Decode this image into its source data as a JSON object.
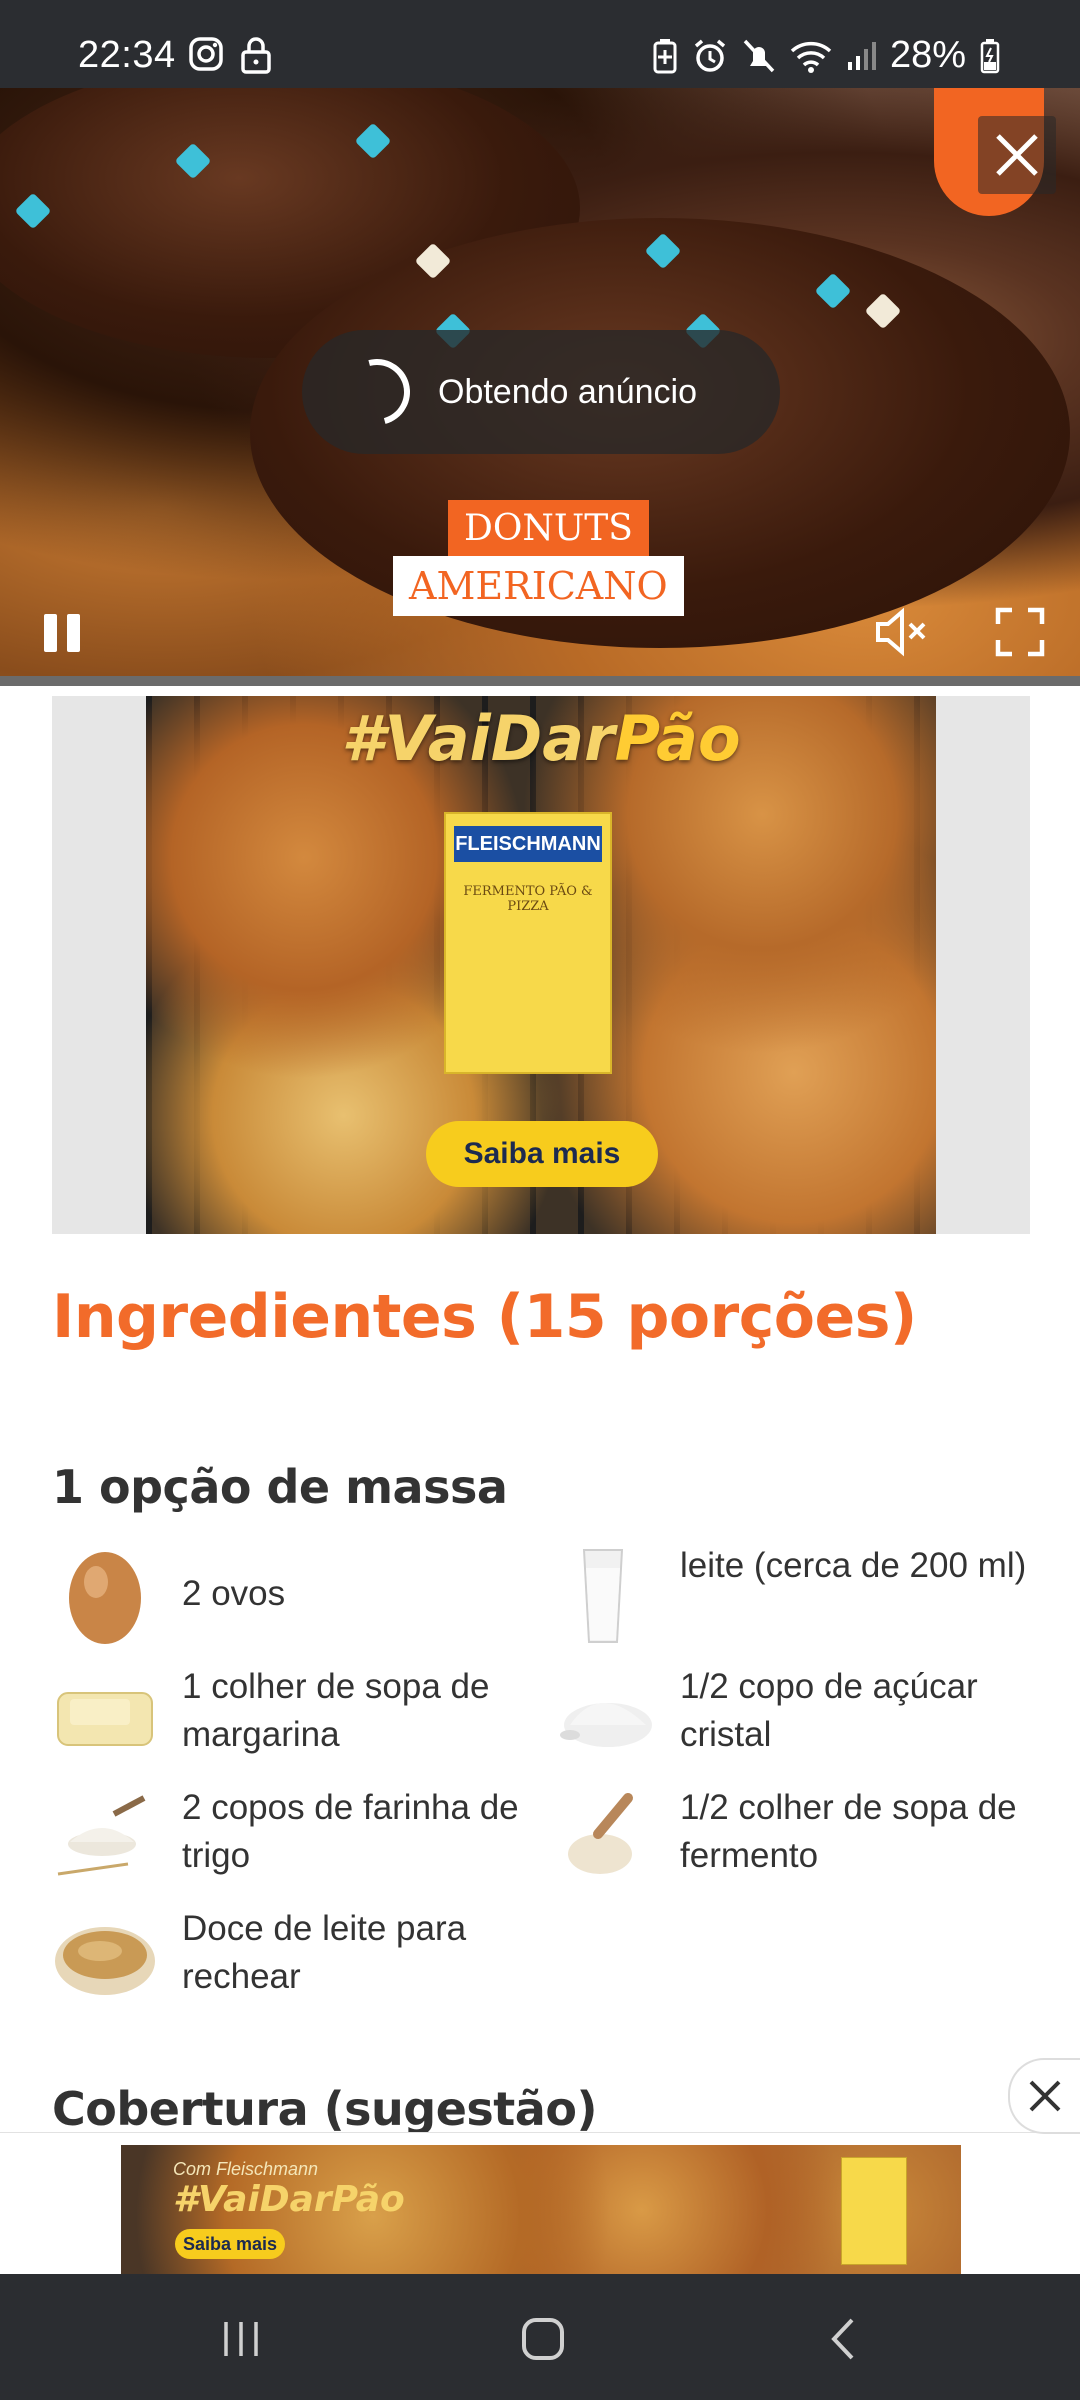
{
  "status_bar": {
    "time": "22:34",
    "battery": "28%",
    "icons": [
      "instagram-icon",
      "lock-icon",
      "battery-saver-icon",
      "alarm-icon",
      "mute-icon",
      "wifi-icon",
      "signal-icon",
      "battery-icon"
    ]
  },
  "video": {
    "loading_text": "Obtendo anúncio",
    "title_line1": "DONUTS",
    "title_line2": "AMERICANO",
    "brand_color": "#f26522"
  },
  "ad_banner": {
    "hashtag_prefix": "#VaiDar",
    "hashtag_highlight": "Pão",
    "pack_brand": "FLEISCHMANN",
    "pack_label": "FERMENTO PÃO & PIZZA",
    "cta": "Saiba mais"
  },
  "recipe": {
    "ingredients_title": "Ingredientes (15 porções)",
    "group1_title": "1 opção de massa",
    "group2_title": "Cobertura (sugestão)",
    "accent_color": "#f26b2a",
    "ingredients": [
      {
        "text": "2 ovos",
        "icon": "egg-icon"
      },
      {
        "text": "leite (cerca de 200 ml)",
        "icon": "milk-icon"
      },
      {
        "text": "1 colher de sopa de margarina",
        "icon": "margarine-icon"
      },
      {
        "text": "1/2 copo de açúcar cristal",
        "icon": "sugar-icon"
      },
      {
        "text": "2 copos de farinha de trigo",
        "icon": "flour-icon"
      },
      {
        "text": "1/2 colher de sopa de fermento",
        "icon": "yeast-icon"
      },
      {
        "text": "Doce de leite para rechear",
        "icon": "dulce-de-leche-icon"
      }
    ]
  },
  "sticky_ad": {
    "small_text": "Com Fleischmann",
    "hashtag": "#VaiDarPão",
    "cta": "Saiba mais"
  }
}
